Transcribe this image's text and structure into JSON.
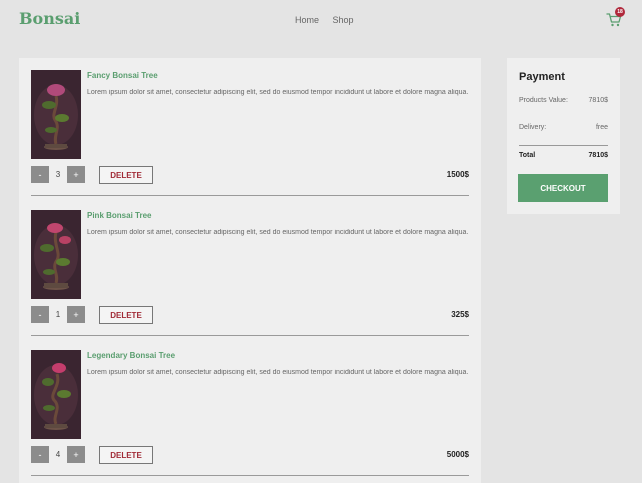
{
  "header": {
    "logo": "Bonsai",
    "nav": [
      "Home",
      "Shop"
    ],
    "cart_count": "18"
  },
  "items": [
    {
      "name": "Fancy Bonsai Tree",
      "description": "Lorem ipsum dolor sit amet, consectetur adipiscing elit, sed do eiusmod tempor incididunt ut labore et dolore magna aliqua.",
      "qty": "3",
      "delete_label": "DELETE",
      "price": "1500$"
    },
    {
      "name": "Pink Bonsai Tree",
      "description": "Lorem ipsum dolor sit amet, consectetur adipiscing elit, sed do eiusmod tempor incididunt ut labore et dolore magna aliqua.",
      "qty": "1",
      "delete_label": "DELETE",
      "price": "325$"
    },
    {
      "name": "Legendary Bonsai Tree",
      "description": "Lorem ipsum dolor sit amet, consectetur adipiscing elit, sed do eiusmod tempor incididunt ut labore et dolore magna aliqua.",
      "qty": "4",
      "delete_label": "DELETE",
      "price": "5000$"
    }
  ],
  "qty_controls": {
    "minus": "-",
    "plus": "+"
  },
  "payment": {
    "title": "Payment",
    "products_label": "Products Value:",
    "products_value": "7810$",
    "delivery_label": "Delivery:",
    "delivery_value": "free",
    "total_label": "Total",
    "total_value": "7810$",
    "checkout_label": "CHECKOUT"
  },
  "colors": {
    "brand_green": "#5a9e6f",
    "checkout_green": "#5aa070",
    "delete_red": "#a02a36",
    "badge_red": "#b0283b"
  },
  "icons": [
    "cart-icon",
    "bonsai-thumbnail"
  ]
}
